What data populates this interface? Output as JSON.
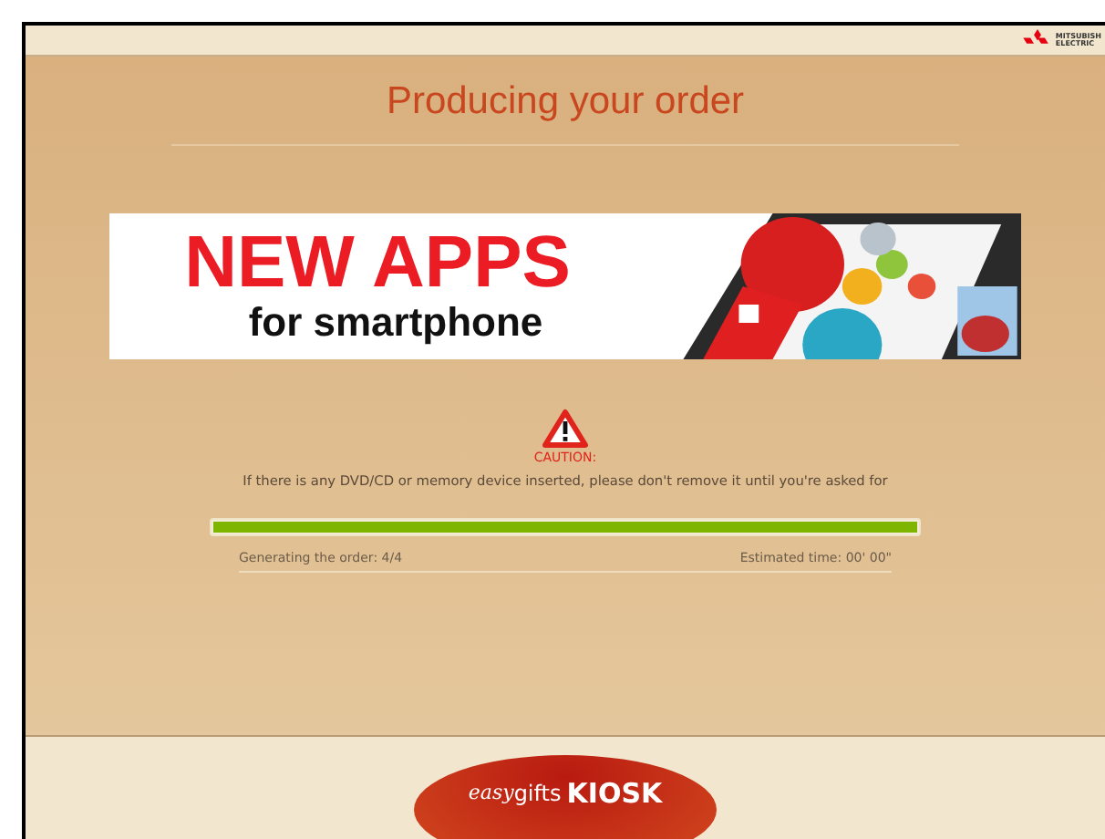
{
  "header": {
    "brand_line_1": "MITSUBISH",
    "brand_line_2": "ELECTRIC"
  },
  "title": "Producing your order",
  "banner": {
    "headline": "NEW APPS",
    "subline": "for smartphone",
    "kind": "picture"
  },
  "caution": {
    "label": "CAUTION:",
    "message": "If there is any DVD/CD or memory device inserted, please don't remove it until you're asked for"
  },
  "progress": {
    "level": 1,
    "status": "Generating the order: 4/4",
    "estimate": "Estimated time: 00' 00\""
  },
  "footer": {
    "logo_script": "easy",
    "logo_word": "gifts",
    "logo_bold": "KIOSK"
  }
}
